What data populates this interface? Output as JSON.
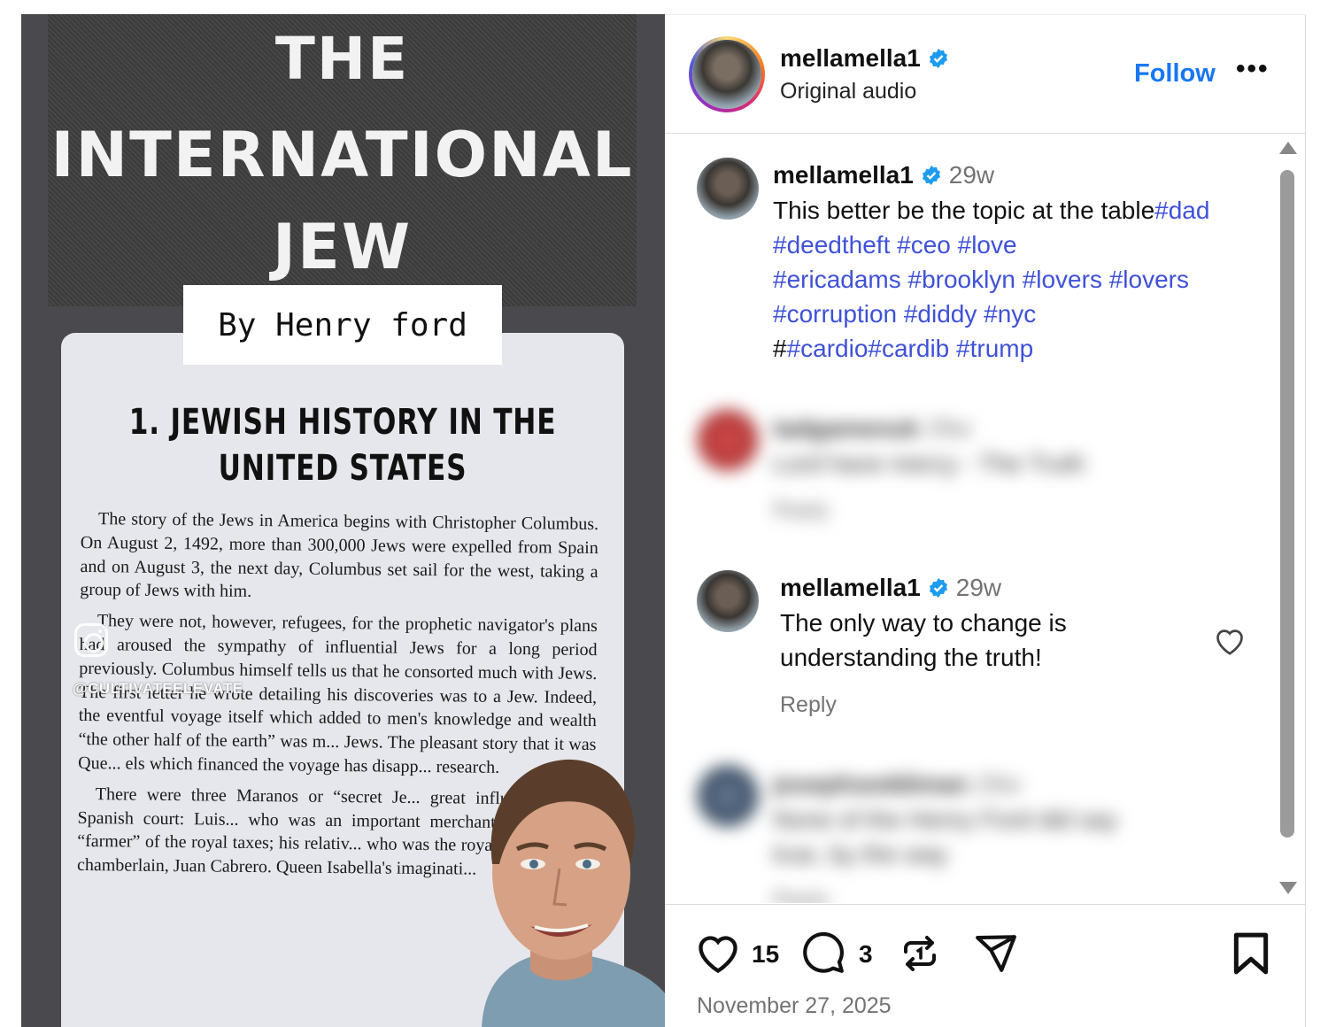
{
  "media": {
    "cover_title_line1": "THE",
    "cover_title_line2": "INTERNATIONAL",
    "cover_title_line3": "JEW",
    "byline": "By Henry ford",
    "chapter_title_line1": "1. JEWISH HISTORY IN THE",
    "chapter_title_line2": "UNITED STATES",
    "paragraph1": "The story of the Jews in America begins with Christopher Columbus. On August 2, 1492, more than 300,000 Jews were expelled from Spain and on August 3, the next day, Columbus set sail for the west, taking a group of Jews with him.",
    "paragraph2": "They were not, however, refugees, for the prophetic navigator's plans had aroused the sympathy of influential Jews for a long period previously. Columbus himself tells us that he consorted much with Jews. The first letter he wrote detailing his discoveries was to a Jew. Indeed, the eventful voyage itself which added to men's knowledge and wealth “the other half of the earth” was m... Jews. The pleasant story that it was Que... els which financed the voyage has disapp... research.",
    "paragraph3": "There were three Maranos or “secret Je... great influence at the Spanish court: Luis... who was an important merchant of Valenci... “farmer” of the royal taxes; his relativ... who was the royal treasurer; a... chamberlain, Juan Cabrero. Queen Isabella's imaginati...",
    "watermark_handle": "@CULTIVATEELEVATE"
  },
  "header": {
    "username": "mellamella1",
    "subtitle": "Original audio",
    "follow_label": "Follow",
    "more_label": "•••"
  },
  "caption": {
    "username": "mellamella1",
    "time": "29w",
    "text_plain": "This better be the topic at the table",
    "line2_tags": "#dad #deedtheft #ceo #love",
    "line3_tags": "#ericadams #brooklyn #lovers #lovers",
    "line4_tags": "#corruption #diddy #nyc",
    "line5_prefix": "#",
    "line5_tags": "#cardio#cardib #trump"
  },
  "comment_blurred_1": {
    "username": "tadgamenuk",
    "time": "29w",
    "text": "Lord have mercy - The Truth",
    "reply_label": "Reply"
  },
  "comment_main": {
    "username": "mellamella1",
    "time": "29w",
    "text_line1": "The only way to change is",
    "text_line2": "understanding the truth!",
    "reply_label": "Reply"
  },
  "comment_blurred_2": {
    "username": "josephseddiman",
    "time": "29w",
    "text_line1": "None of the Henry Ford did say",
    "text_line2": "true, by the way",
    "reply_label": "Reply"
  },
  "actions": {
    "like_count": "15",
    "comment_count": "3",
    "date": "November 27, 2025"
  },
  "colors": {
    "link_blue": "#1877f2",
    "hashtag": "#3f51d8",
    "muted": "#737373",
    "verified": "#1d9bf0"
  },
  "icons": [
    "heart-icon",
    "comment-icon",
    "repost-icon",
    "share-icon",
    "bookmark-icon",
    "verified-badge-icon",
    "instagram-icon",
    "more-icon"
  ]
}
